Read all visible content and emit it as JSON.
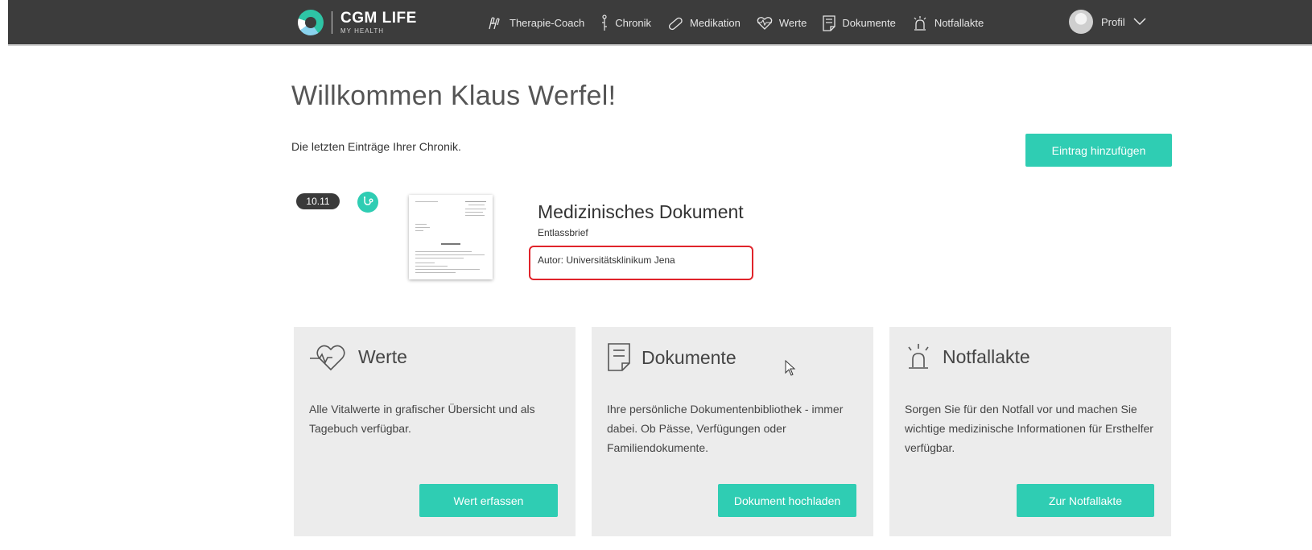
{
  "header": {
    "logo_title": "CGM LIFE",
    "logo_subtitle": "MY HEALTH",
    "nav": [
      {
        "label": "Therapie-Coach",
        "icon": "coach-icon"
      },
      {
        "label": "Chronik",
        "icon": "chronik-icon"
      },
      {
        "label": "Medikation",
        "icon": "pill-icon"
      },
      {
        "label": "Werte",
        "icon": "heart-pulse-icon"
      },
      {
        "label": "Dokumente",
        "icon": "document-icon"
      },
      {
        "label": "Notfallakte",
        "icon": "alarm-icon"
      }
    ],
    "profile_label": "Profil"
  },
  "main": {
    "welcome": "Willkommen Klaus Werfel!",
    "subtitle": "Die letzten Einträge Ihrer Chronik.",
    "add_entry_label": "Eintrag hinzufügen",
    "entry": {
      "date": "10.11",
      "icon": "stethoscope-icon",
      "title": "Medizinisches Dokument",
      "type": "Entlassbrief",
      "author": "Autor: Universitätsklinikum Jena"
    }
  },
  "cards": [
    {
      "title": "Werte",
      "icon": "heart-pulse-icon",
      "text": "Alle Vitalwerte in grafischer Übersicht und als Tagebuch verfügbar.",
      "button": "Wert erfassen"
    },
    {
      "title": "Dokumente",
      "icon": "document-icon",
      "text": "Ihre persönliche Dokumentenbibliothek - immer dabei. Ob Pässe, Verfügungen oder Familiendokumente.",
      "button": "Dokument hochladen"
    },
    {
      "title": "Notfallakte",
      "icon": "alarm-icon",
      "text": "Sorgen Sie für den Notfall vor und machen Sie wichtige medizinische Informationen für Ersthelfer verfügbar.",
      "button": "Zur Notfallakte"
    }
  ],
  "colors": {
    "accent": "#2fcdb3",
    "topbar": "#3c3c3c",
    "card_bg": "#ececec",
    "highlight": "#e0242b"
  }
}
